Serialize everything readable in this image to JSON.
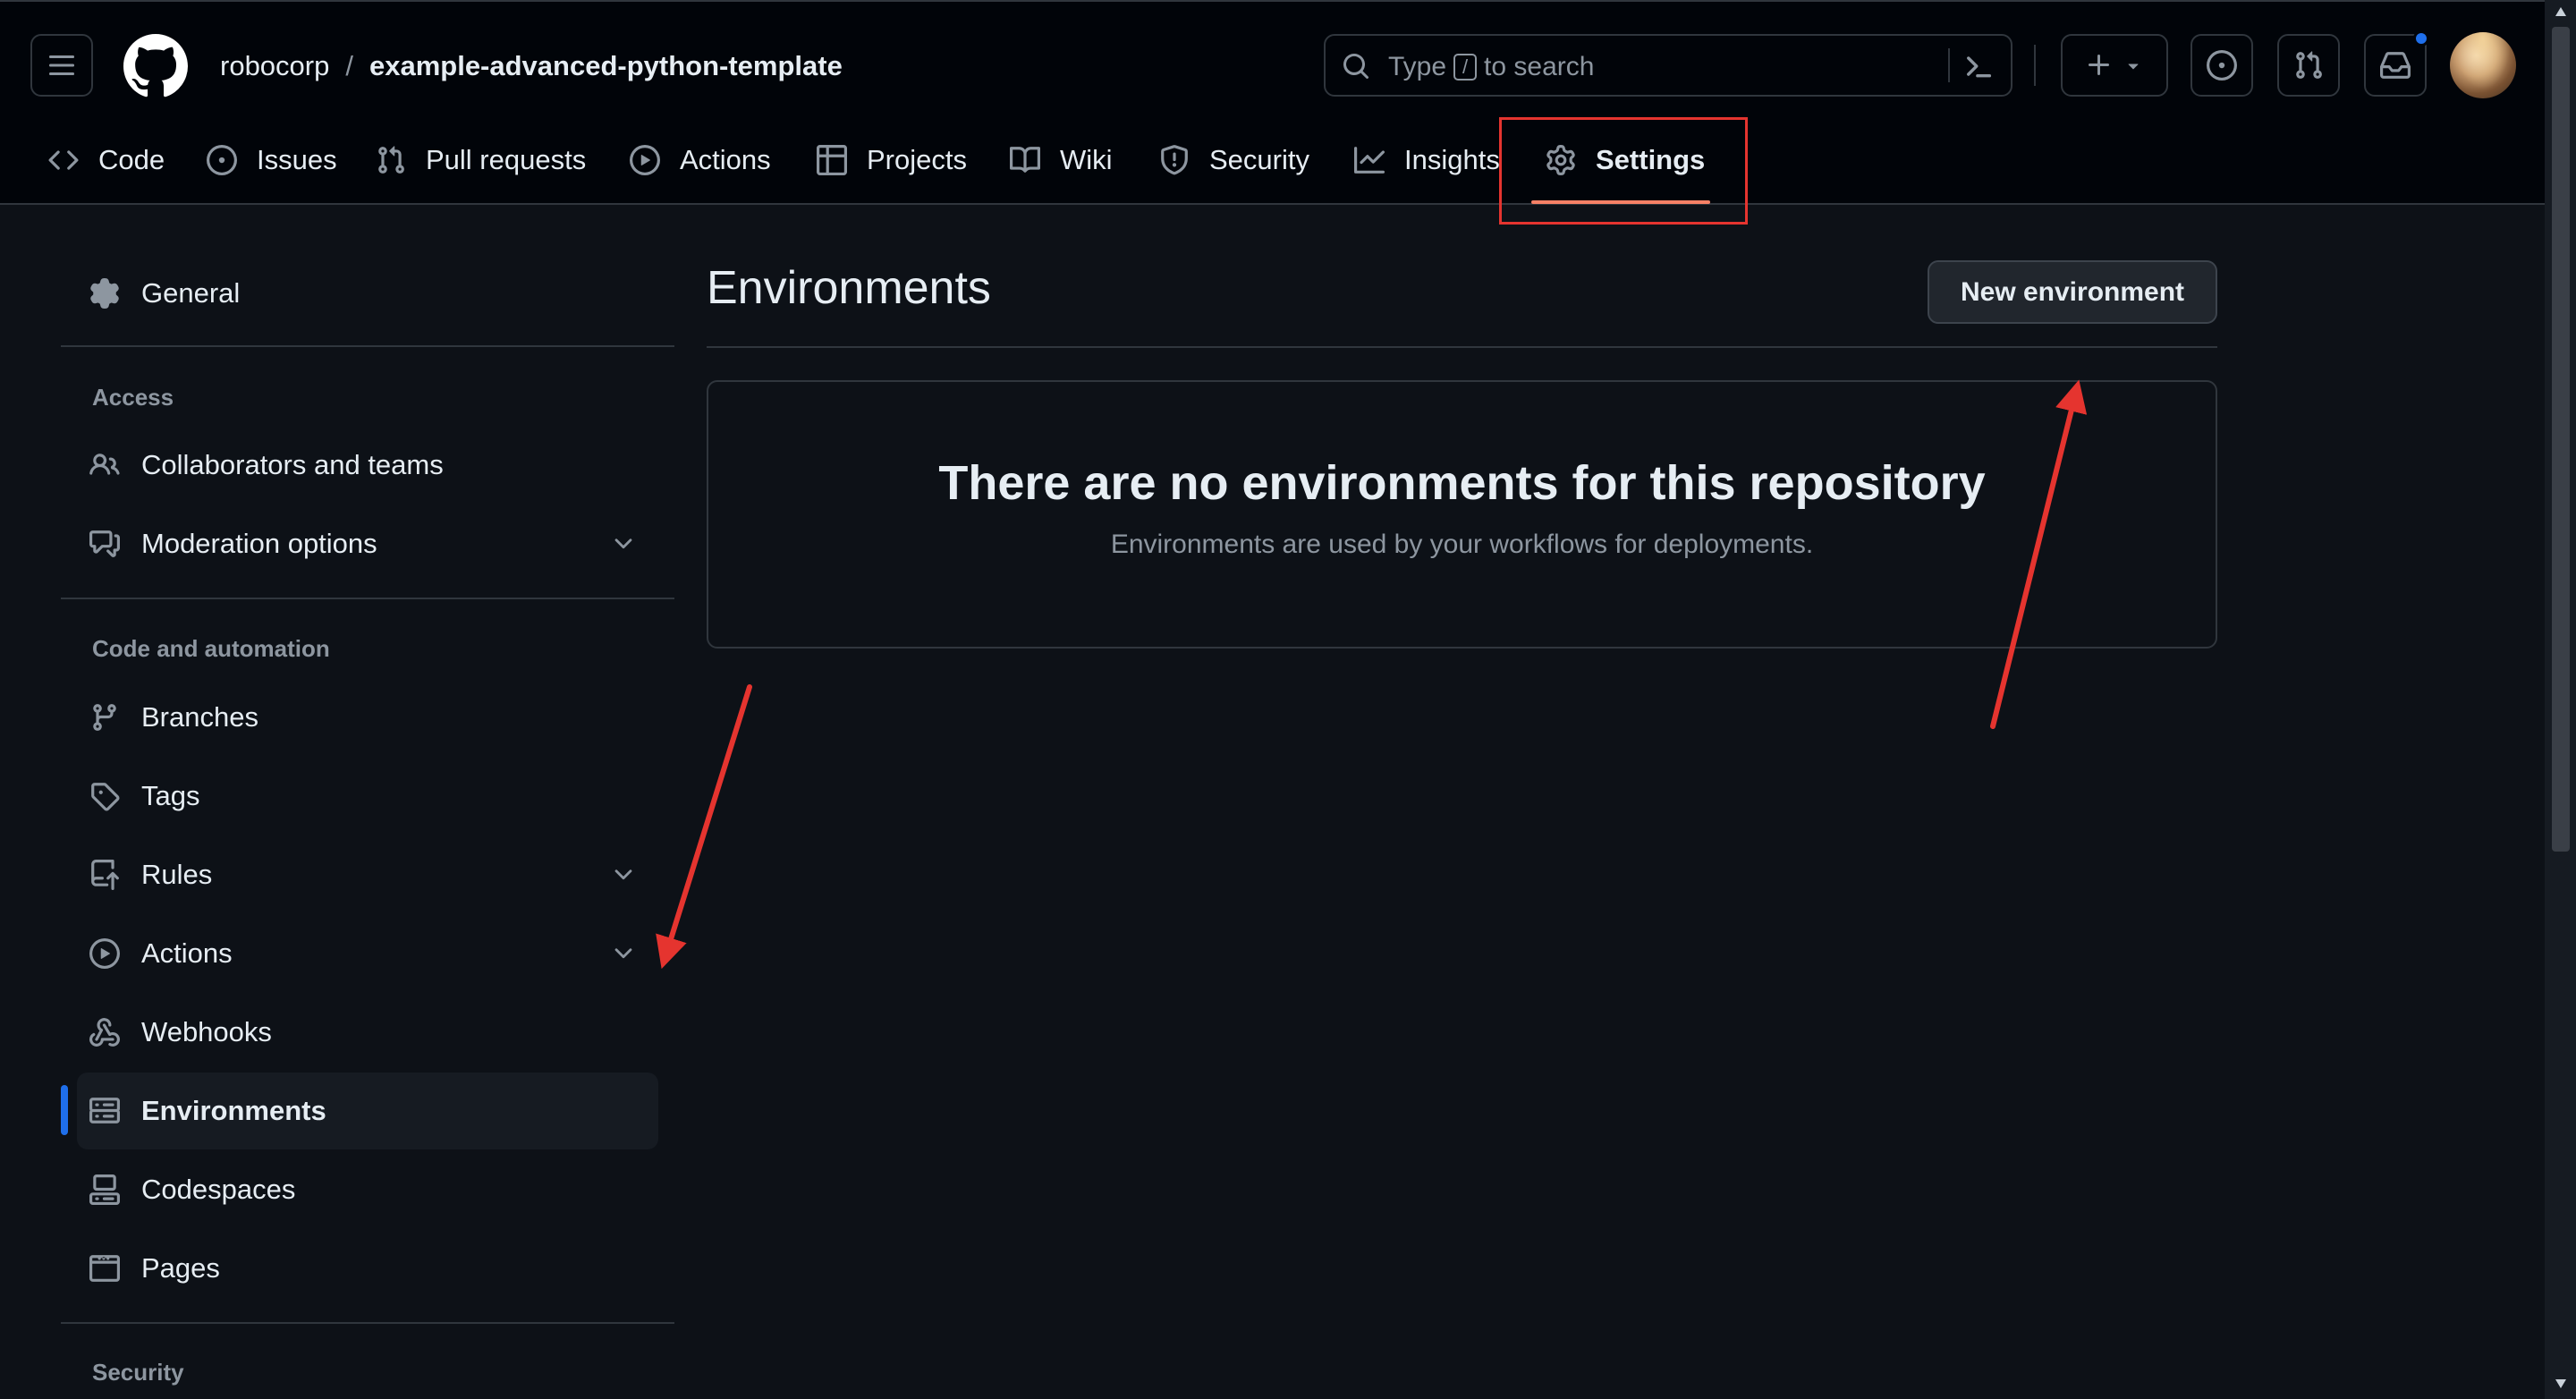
{
  "header": {
    "owner": "robocorp",
    "separator": "/",
    "repo": "example-advanced-python-template",
    "search": {
      "prefix": "Type",
      "key": "/",
      "suffix": "to search"
    }
  },
  "tabs": [
    {
      "label": "Code",
      "icon": "code-icon"
    },
    {
      "label": "Issues",
      "icon": "issue-icon"
    },
    {
      "label": "Pull requests",
      "icon": "pull-request-icon"
    },
    {
      "label": "Actions",
      "icon": "play-icon"
    },
    {
      "label": "Projects",
      "icon": "table-icon"
    },
    {
      "label": "Wiki",
      "icon": "book-icon"
    },
    {
      "label": "Security",
      "icon": "shield-icon"
    },
    {
      "label": "Insights",
      "icon": "graph-icon"
    },
    {
      "label": "Settings",
      "icon": "gear-icon",
      "active": true
    }
  ],
  "sidebar": {
    "general": "General",
    "access_heading": "Access",
    "collaborators": "Collaborators and teams",
    "moderation": "Moderation options",
    "code_heading": "Code and automation",
    "branches": "Branches",
    "tags": "Tags",
    "rules": "Rules",
    "actions": "Actions",
    "webhooks": "Webhooks",
    "environments": "Environments",
    "codespaces": "Codespaces",
    "pages": "Pages",
    "security_heading": "Security"
  },
  "main": {
    "title": "Environments",
    "new_button": "New environment",
    "blank_title": "There are no environments for this repository",
    "blank_desc": "Environments are used by your workflows for deployments."
  },
  "colors": {
    "background": "#0d1117",
    "header_bg": "#010409",
    "accent_blue": "#1f6feb",
    "tab_underline": "#f78166",
    "annotation_red": "#e5342f"
  }
}
